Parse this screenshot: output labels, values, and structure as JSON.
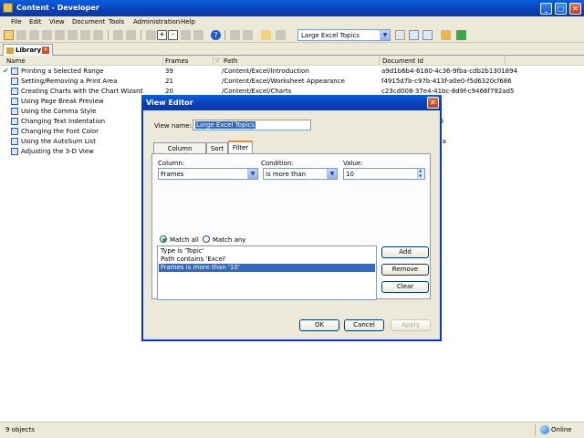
{
  "window": {
    "title": "Content - Developer"
  },
  "menu": [
    "File",
    "Edit",
    "View",
    "Document",
    "Tools",
    "Administration",
    "Help"
  ],
  "toolbar": {
    "view_select_value": "Large Excel Topics"
  },
  "tab": {
    "label": "Library"
  },
  "table": {
    "columns": [
      "Name",
      "Frames",
      "Path",
      "Document Id"
    ],
    "rows": [
      {
        "name": "Printing a Selected Range",
        "frames": "39",
        "path": "/Content/Excel/Introduction",
        "docid": "a9d1b6b4-6180-4c36-9fba-cdb2b1301894",
        "checked": true
      },
      {
        "name": "Setting/Removing a Print Area",
        "frames": "21",
        "path": "/Content/Excel/Worksheet Appearance",
        "docid": "f4915d7b-c97b-413f-a0e0-f5d6320cf686",
        "checked": false
      },
      {
        "name": "Creating Charts with the Chart Wizard",
        "frames": "20",
        "path": "/Content/Excel/Charts",
        "docid": "c23cd008-37e4-41bc-8d9f-c9466f792ad5",
        "checked": false
      },
      {
        "name": "Using Page Break Preview",
        "frames": "",
        "path": "",
        "docid": "b1-404b7c0a409f",
        "checked": false
      },
      {
        "name": "Using the Comma Style",
        "frames": "",
        "path": "",
        "docid": "ac4-ab86d4def90a",
        "checked": false
      },
      {
        "name": "Changing Text Indentation",
        "frames": "",
        "path": "",
        "docid": "65d-4c45b186c216",
        "checked": false
      },
      {
        "name": "Changing the Font Color",
        "frames": "",
        "path": "",
        "docid": "ea7-d2f2da32e6a8",
        "checked": false
      },
      {
        "name": "Using the AutoSum List",
        "frames": "",
        "path": "",
        "docid": "9ef8-bcd37431272a",
        "checked": false
      },
      {
        "name": "Adjusting the 3-D View",
        "frames": "",
        "path": "",
        "docid": "d49-f0aeb36b7381",
        "checked": false
      }
    ]
  },
  "status": {
    "count": "9 objects",
    "online": "Online"
  },
  "dialog": {
    "title": "View Editor",
    "view_name_label": "View name:",
    "view_name_value": "Large Excel Topics",
    "tabs": [
      "Column Selection",
      "Sort",
      "Filter"
    ],
    "column_label": "Column:",
    "column_value": "Frames",
    "condition_label": "Condition:",
    "condition_value": "is more than",
    "value_label": "Value:",
    "value_value": "10",
    "match_all": "Match all",
    "match_any": "Match any",
    "conditions": [
      "Type is 'Topic'",
      "Path contains 'Excel'",
      "Frames is more than '10'"
    ],
    "add": "Add",
    "remove": "Remove",
    "clear": "Clear",
    "ok": "OK",
    "cancel": "Cancel",
    "apply": "Apply"
  }
}
